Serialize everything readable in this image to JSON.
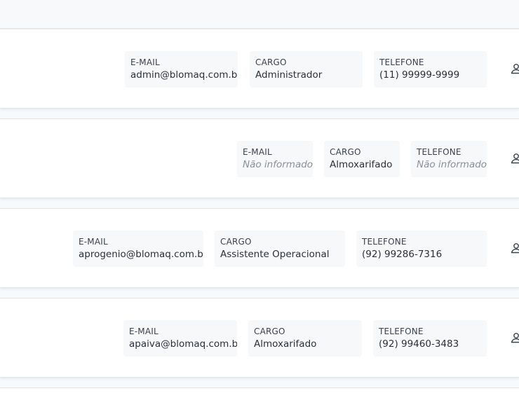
{
  "users": [
    {
      "email_label": "E-MAIL",
      "email": "admin@blomaq.com.br",
      "cargo_label": "CARGO",
      "cargo": "Administrador",
      "telefone_label": "TELEFONE",
      "telefone": "(11) 99999-9999",
      "action_icon": "user-icon"
    },
    {
      "email_label": "E-MAIL",
      "email": "Não informado",
      "cargo_label": "CARGO",
      "cargo": "Almoxarifado",
      "telefone_label": "TELEFONE",
      "telefone": "Não informado",
      "action_icon": "user-icon"
    },
    {
      "email_label": "E-MAIL",
      "email": "aprogenio@blomaq.com.br",
      "cargo_label": "CARGO",
      "cargo": "Assistente Operacional",
      "telefone_label": "TELEFONE",
      "telefone": "(92) 99286-7316",
      "action_icon": "user-icon"
    },
    {
      "email_label": "E-MAIL",
      "email": "apaiva@blomaq.com.br",
      "cargo_label": "CARGO",
      "cargo": "Almoxarifado",
      "telefone_label": "TELEFONE",
      "telefone": "(92) 99460-3483",
      "action_icon": "user-icon"
    }
  ],
  "colors": {
    "background": "#f8f9fb",
    "card": "#ffffff",
    "field_bg": "#f7f8fa",
    "label": "#3a414b",
    "value": "#2b3038",
    "placeholder": "#8a9099"
  }
}
